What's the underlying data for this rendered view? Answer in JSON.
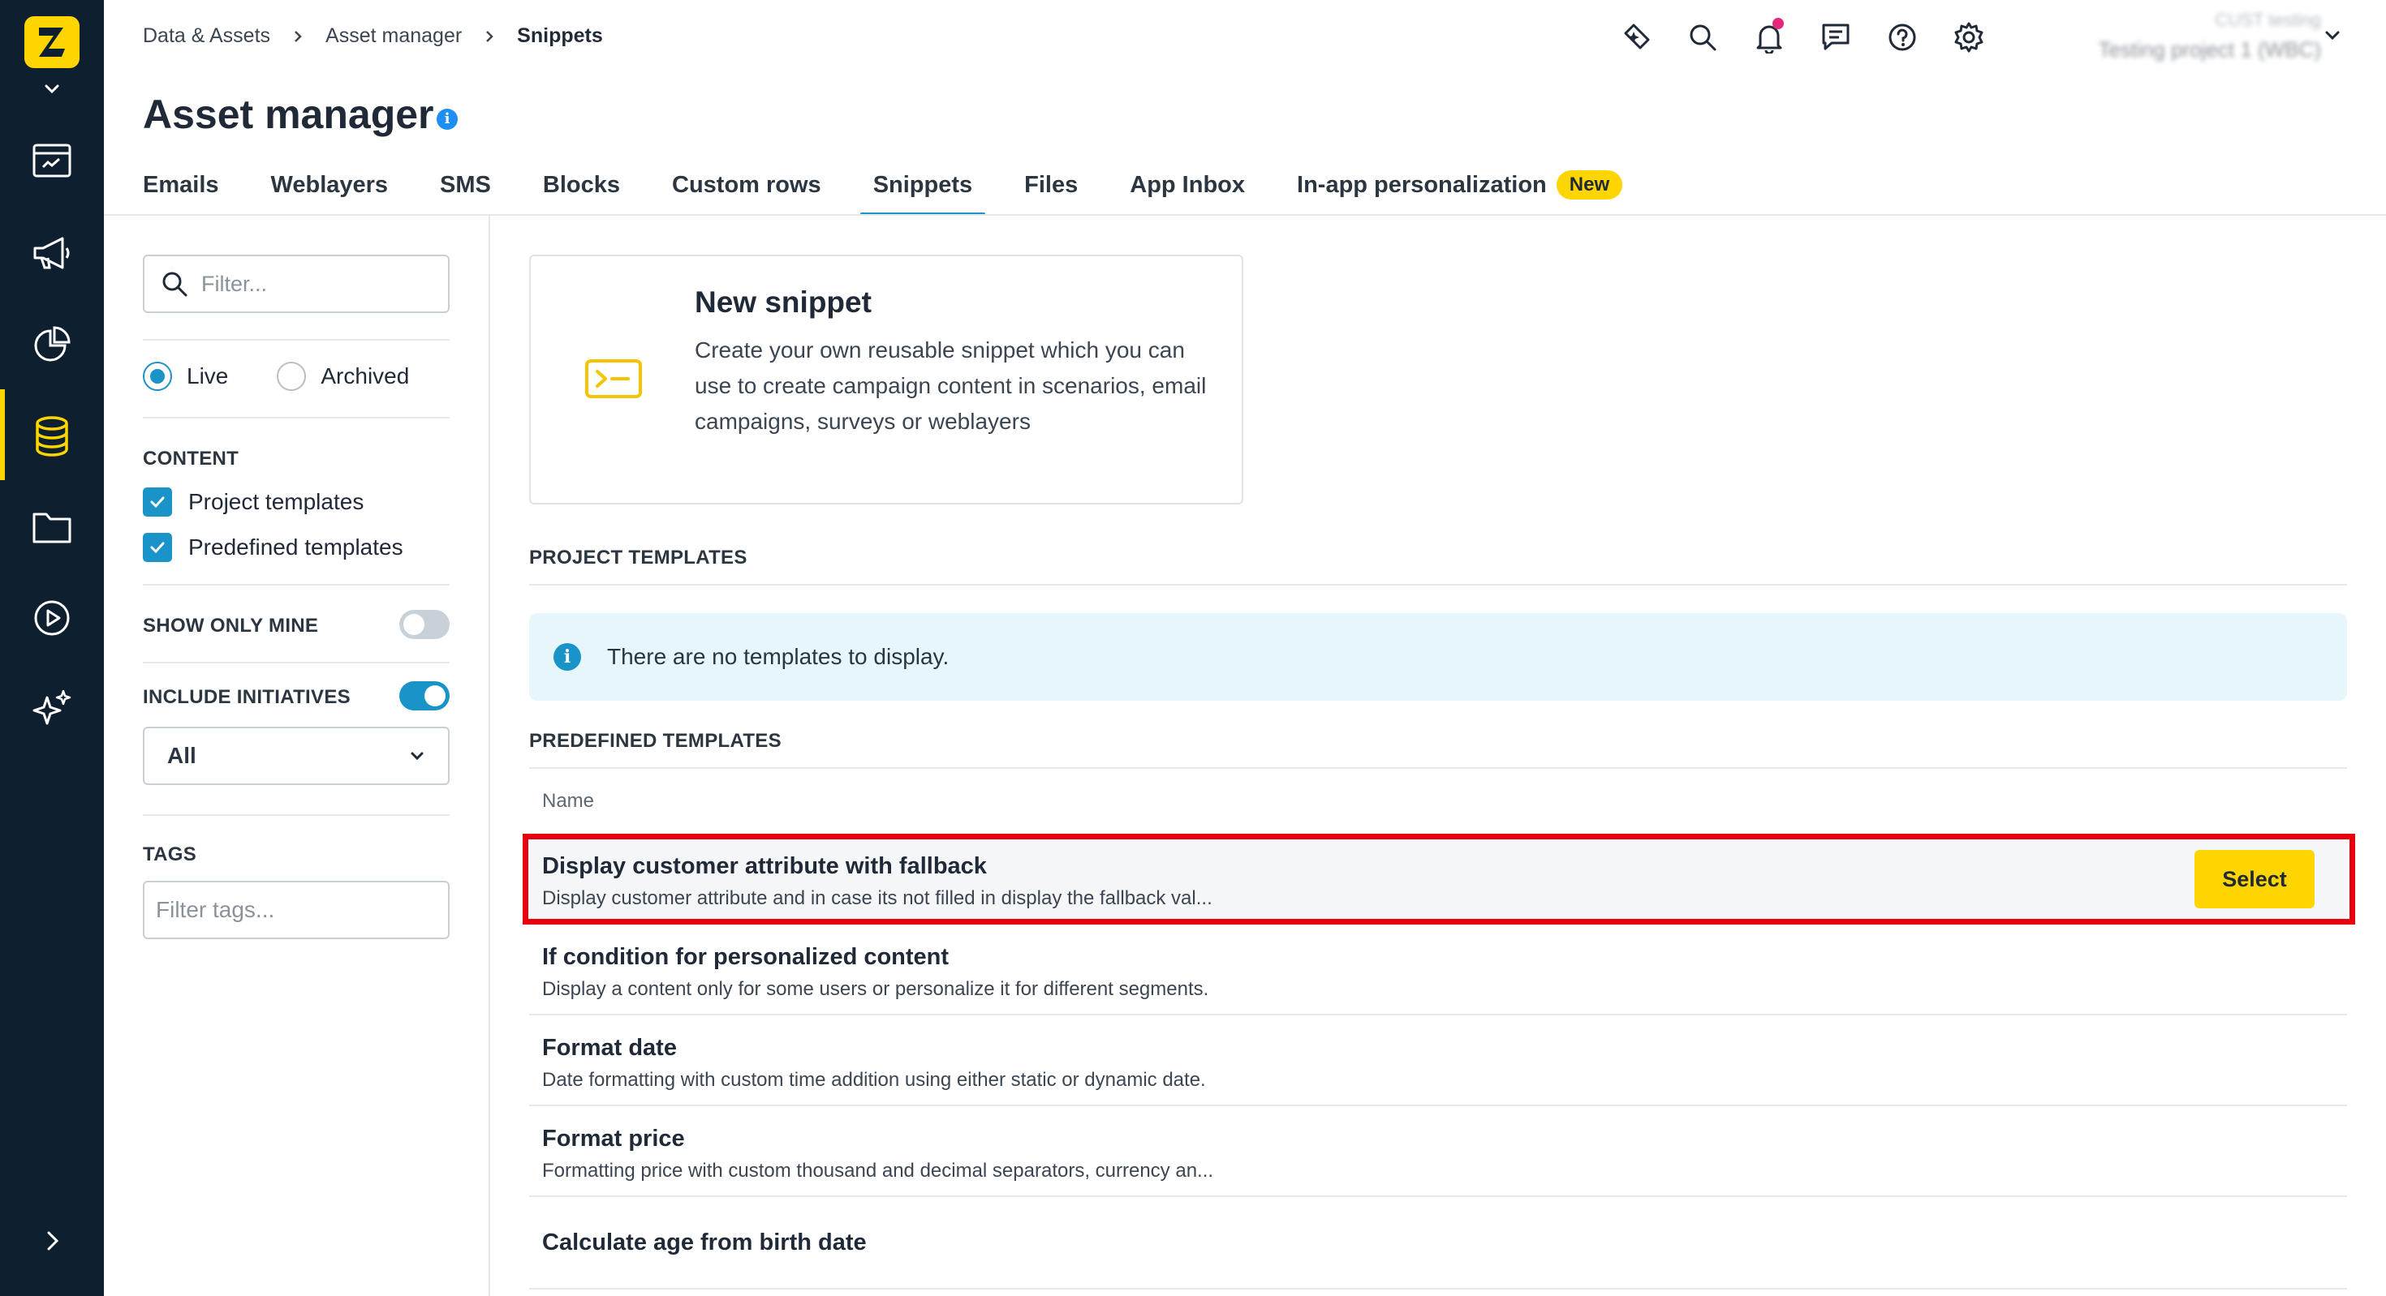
{
  "breadcrumb": {
    "items": [
      "Data & Assets",
      "Asset manager"
    ],
    "current": "Snippets"
  },
  "page": {
    "title": "Asset manager"
  },
  "project": {
    "line1": "CUST testing",
    "line2": "Testing project 1 (WBC)"
  },
  "tabs": [
    {
      "label": "Emails"
    },
    {
      "label": "Weblayers"
    },
    {
      "label": "SMS"
    },
    {
      "label": "Blocks"
    },
    {
      "label": "Custom rows"
    },
    {
      "label": "Snippets",
      "active": true
    },
    {
      "label": "Files"
    },
    {
      "label": "App Inbox"
    },
    {
      "label": "In-app personalization",
      "badge": "New"
    }
  ],
  "filters": {
    "search_placeholder": "Filter...",
    "status": {
      "live": "Live",
      "archived": "Archived",
      "selected": "Live"
    },
    "content_heading": "CONTENT",
    "content_options": [
      {
        "label": "Project templates",
        "checked": true
      },
      {
        "label": "Predefined templates",
        "checked": true
      }
    ],
    "show_only_mine": {
      "label": "SHOW ONLY MINE",
      "on": false
    },
    "include_initiatives": {
      "label": "INCLUDE INITIATIVES",
      "on": true
    },
    "initiative_select": "All",
    "tags_heading": "TAGS",
    "tags_placeholder": "Filter tags..."
  },
  "new_snippet": {
    "title": "New snippet",
    "description": "Create your own reusable snippet which you can use to create campaign content in scenarios, email campaigns, surveys or weblayers"
  },
  "project_templates": {
    "heading": "PROJECT TEMPLATES",
    "empty_message": "There are no templates to display."
  },
  "predefined_templates": {
    "heading": "PREDEFINED TEMPLATES",
    "column_name": "Name",
    "select_label": "Select",
    "rows": [
      {
        "title": "Display customer attribute with fallback",
        "description": "Display customer attribute and in case its not filled in display the fallback val...",
        "highlighted": true
      },
      {
        "title": "If condition for personalized content",
        "description": "Display a content only for some users or personalize it for different segments."
      },
      {
        "title": "Format date",
        "description": "Date formatting with custom time addition using either static or dynamic date."
      },
      {
        "title": "Format price",
        "description": "Formatting price with custom thousand and decimal separators, currency an..."
      },
      {
        "title": "Calculate age from birth date",
        "description": ""
      }
    ]
  },
  "colors": {
    "brand_yellow": "#ffd500",
    "nav_bg": "#0e1f2f",
    "accent_blue": "#1a93c9",
    "highlight_red": "#e8000f",
    "notification_pink": "#e6287a"
  },
  "icons": [
    "logo-icon",
    "chevron-down-icon",
    "dashboard-icon",
    "megaphone-icon",
    "pie-chart-icon",
    "database-icon",
    "folder-icon",
    "play-icon",
    "sparkle-icon",
    "chevron-right-icon",
    "ai-sparkle-icon",
    "search-icon",
    "bell-icon",
    "chat-icon",
    "help-icon",
    "gear-icon",
    "info-icon",
    "terminal-icon",
    "check-icon"
  ]
}
